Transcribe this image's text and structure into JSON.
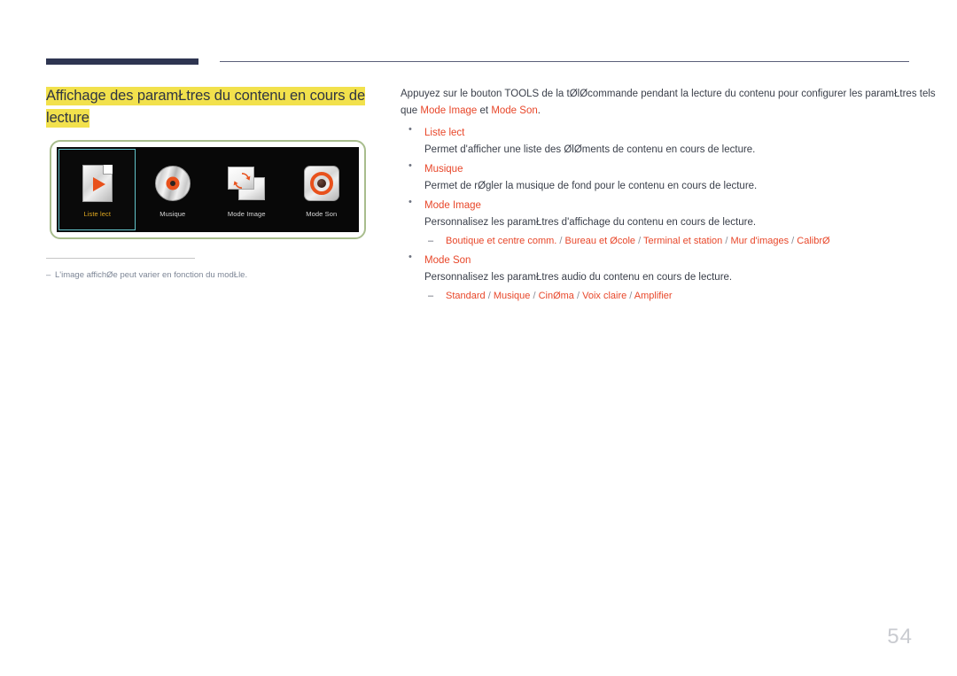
{
  "page": {
    "number": "54",
    "title_line1": "Affichage des paramŁtres du contenu en cours de",
    "title_line2": "lecture",
    "accent_color": "#e8472a",
    "highlight_color": "#f2e14c",
    "rule_color": "#2e3551"
  },
  "device_screenshot": {
    "frame_border_color": "#a8bd8d",
    "screen_background": "#080808",
    "selected_border_color": "#63c5cc",
    "selected_label_color": "#e0a820",
    "items": [
      {
        "label": "Liste lect",
        "icon": "playlist-document-icon",
        "selected": true
      },
      {
        "label": "Musique",
        "icon": "music-disc-icon",
        "selected": false
      },
      {
        "label": "Mode Image",
        "icon": "picture-mode-cards-icon",
        "selected": false
      },
      {
        "label": "Mode Son",
        "icon": "sound-mode-ring-icon",
        "selected": false
      }
    ]
  },
  "footnote": {
    "dash": "–",
    "text": "L'image affichØe peut varier en fonction du modŁle."
  },
  "body": {
    "intro_part1": "Appuyez sur le bouton TOOLS de la tØlØcommande pendant la lecture du contenu pour configurer les paramŁtres tels que ",
    "intro_accent1": "Mode Image",
    "intro_part2": " et ",
    "intro_accent2": "Mode Son",
    "intro_part3": ".",
    "bullets": [
      {
        "title": "Liste lect",
        "desc": "Permet d'afficher une liste des ØlØments de contenu en cours de lecture.",
        "options": []
      },
      {
        "title": "Musique",
        "desc": "Permet de rØgler la musique de fond pour le contenu en cours de lecture.",
        "options": []
      },
      {
        "title": "Mode Image",
        "desc": "Personnalisez les paramŁtres d'affichage du contenu en cours de lecture.",
        "options": [
          "Boutique et centre comm.",
          "Bureau et Øcole",
          "Terminal et station",
          "Mur d'images",
          "CalibrØ"
        ]
      },
      {
        "title": "Mode Son",
        "desc": "Personnalisez les paramŁtres audio du contenu en cours de lecture.",
        "options": [
          "Standard",
          "Musique",
          "CinØma",
          "Voix claire",
          "Amplifier"
        ]
      }
    ]
  }
}
